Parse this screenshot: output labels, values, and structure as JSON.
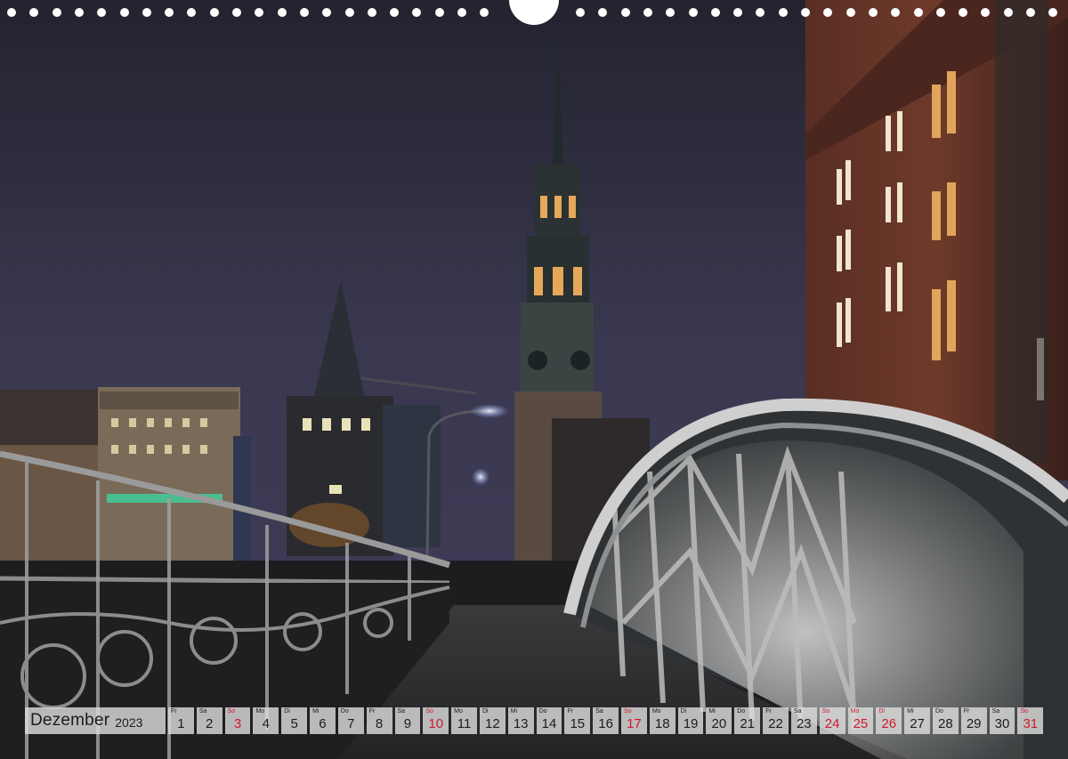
{
  "calendar": {
    "month": "Dezember",
    "year": "2023",
    "days": [
      {
        "wd": "Fr",
        "d": "1",
        "red": false
      },
      {
        "wd": "Sa",
        "d": "2",
        "red": false
      },
      {
        "wd": "So",
        "d": "3",
        "red": true
      },
      {
        "wd": "Mo",
        "d": "4",
        "red": false
      },
      {
        "wd": "Di",
        "d": "5",
        "red": false
      },
      {
        "wd": "Mi",
        "d": "6",
        "red": false
      },
      {
        "wd": "Do",
        "d": "7",
        "red": false
      },
      {
        "wd": "Fr",
        "d": "8",
        "red": false
      },
      {
        "wd": "Sa",
        "d": "9",
        "red": false
      },
      {
        "wd": "So",
        "d": "10",
        "red": true
      },
      {
        "wd": "Mo",
        "d": "11",
        "red": false
      },
      {
        "wd": "Di",
        "d": "12",
        "red": false
      },
      {
        "wd": "Mi",
        "d": "13",
        "red": false
      },
      {
        "wd": "Do",
        "d": "14",
        "red": false
      },
      {
        "wd": "Fr",
        "d": "15",
        "red": false
      },
      {
        "wd": "Sa",
        "d": "16",
        "red": false
      },
      {
        "wd": "So",
        "d": "17",
        "red": true
      },
      {
        "wd": "Mo",
        "d": "18",
        "red": false
      },
      {
        "wd": "Di",
        "d": "19",
        "red": false
      },
      {
        "wd": "Mi",
        "d": "20",
        "red": false
      },
      {
        "wd": "Do",
        "d": "21",
        "red": false
      },
      {
        "wd": "Fr",
        "d": "22",
        "red": false
      },
      {
        "wd": "Sa",
        "d": "23",
        "red": false
      },
      {
        "wd": "So",
        "d": "24",
        "red": true
      },
      {
        "wd": "Mo",
        "d": "25",
        "red": true
      },
      {
        "wd": "Di",
        "d": "26",
        "red": true
      },
      {
        "wd": "Mi",
        "d": "27",
        "red": false
      },
      {
        "wd": "Do",
        "d": "28",
        "red": false
      },
      {
        "wd": "Fr",
        "d": "29",
        "red": false
      },
      {
        "wd": "Sa",
        "d": "30",
        "red": false
      },
      {
        "wd": "So",
        "d": "31",
        "red": true
      }
    ]
  },
  "colors": {
    "holiday_red": "#d0192b",
    "strip_background": "#dcdcdc"
  }
}
